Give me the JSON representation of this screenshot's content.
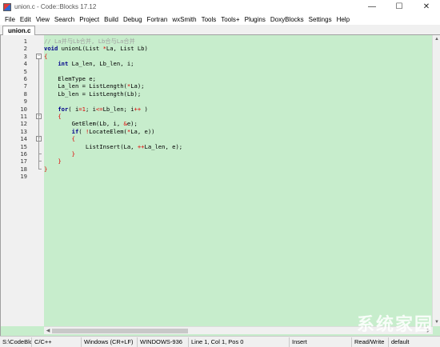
{
  "window": {
    "title": "union.c - Code::Blocks 17.12",
    "min": "—",
    "max": "☐",
    "close": "✕"
  },
  "menu": [
    "File",
    "Edit",
    "View",
    "Search",
    "Project",
    "Build",
    "Debug",
    "Fortran",
    "wxSmith",
    "Tools",
    "Tools+",
    "Plugins",
    "DoxyBlocks",
    "Settings",
    "Help"
  ],
  "tab": {
    "label": "union.c"
  },
  "editor": {
    "line_numbers": [
      "1",
      "2",
      "3",
      "4",
      "5",
      "6",
      "7",
      "8",
      "9",
      "10",
      "11",
      "12",
      "13",
      "14",
      "15",
      "16",
      "17",
      "18",
      "19"
    ],
    "lines": [
      [
        [
          "tok-comment",
          "// La并与Lb合并, Lb合与La合并"
        ]
      ],
      [
        [
          "tok-kw",
          "void"
        ],
        [
          "tok-plain",
          " unionL(List "
        ],
        [
          "tok-op",
          "*"
        ],
        [
          "tok-plain",
          "La, List Lb)"
        ]
      ],
      [
        [
          "tok-op",
          "{"
        ]
      ],
      [
        [
          "tok-plain",
          "    "
        ],
        [
          "tok-kw",
          "int"
        ],
        [
          "tok-plain",
          " La_len, Lb_len, i;"
        ]
      ],
      [],
      [
        [
          "tok-plain",
          "    ElemType e;"
        ]
      ],
      [
        [
          "tok-plain",
          "    La_len = ListLength("
        ],
        [
          "tok-op",
          "*"
        ],
        [
          "tok-plain",
          "La);"
        ]
      ],
      [
        [
          "tok-plain",
          "    Lb_len = ListLength(Lb);"
        ]
      ],
      [],
      [
        [
          "tok-plain",
          "    "
        ],
        [
          "tok-kw",
          "for"
        ],
        [
          "tok-plain",
          "( i"
        ],
        [
          "tok-op",
          "="
        ],
        [
          "tok-num",
          "1"
        ],
        [
          "tok-plain",
          "; i"
        ],
        [
          "tok-op",
          "<="
        ],
        [
          "tok-plain",
          "Lb_len; i"
        ],
        [
          "tok-op",
          "++"
        ],
        [
          "tok-plain",
          " )"
        ]
      ],
      [
        [
          "tok-plain",
          "    "
        ],
        [
          "tok-op",
          "{"
        ]
      ],
      [
        [
          "tok-plain",
          "        GetElem(Lb, i, "
        ],
        [
          "tok-op",
          "&"
        ],
        [
          "tok-plain",
          "e);"
        ]
      ],
      [
        [
          "tok-plain",
          "        "
        ],
        [
          "tok-kw",
          "if"
        ],
        [
          "tok-plain",
          "( "
        ],
        [
          "tok-op",
          "!"
        ],
        [
          "tok-plain",
          "LocateElem("
        ],
        [
          "tok-op",
          "*"
        ],
        [
          "tok-plain",
          "La, e))"
        ]
      ],
      [
        [
          "tok-plain",
          "        "
        ],
        [
          "tok-op",
          "{"
        ]
      ],
      [
        [
          "tok-plain",
          "            ListInsert(La, "
        ],
        [
          "tok-op",
          "++"
        ],
        [
          "tok-plain",
          "La_len, e);"
        ]
      ],
      [
        [
          "tok-plain",
          "        "
        ],
        [
          "tok-op",
          "}"
        ]
      ],
      [
        [
          "tok-plain",
          "    "
        ],
        [
          "tok-op",
          "}"
        ]
      ],
      [
        [
          "tok-op",
          "}"
        ]
      ],
      []
    ]
  },
  "status": {
    "path": "S:\\CodeBlocks",
    "language": "C/C++",
    "line_endings": "Windows (CR+LF)",
    "encoding": "WINDOWS-936",
    "position": "Line 1, Col 1, Pos 0",
    "mode": "Insert",
    "access": "Read/Write",
    "profile": "default"
  },
  "watermark": "系统家园"
}
